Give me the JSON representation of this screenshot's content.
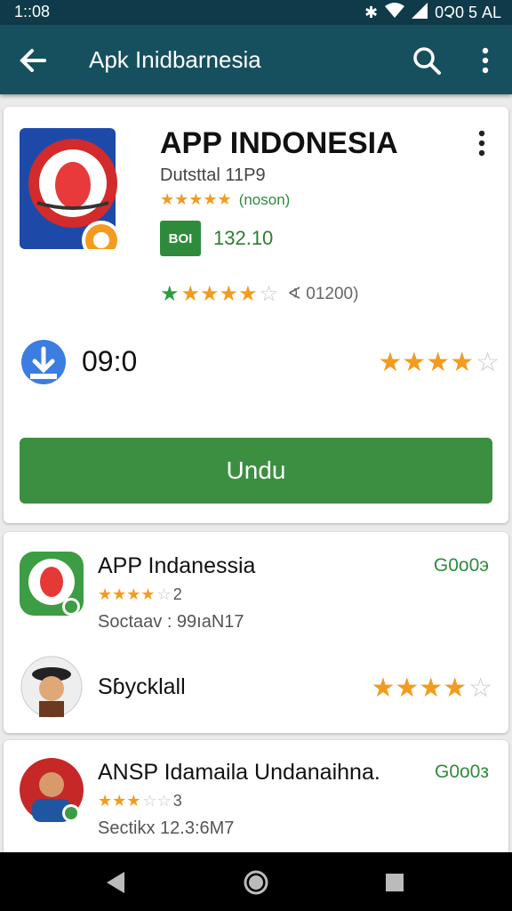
{
  "status_bar": {
    "time": "1::08",
    "right_text": "0Չ0 5 AL"
  },
  "app_bar": {
    "title": "Apk Inidbarnesia"
  },
  "main_app": {
    "title": "APP INDONESIA",
    "developer": "Dutsttal 11P9",
    "rating_stars": "★★★★★",
    "rating_reviews": "(noson)",
    "badge_label": "BOI",
    "size": "132.10",
    "review_count": "∢ 01200)",
    "install_count": "09:0",
    "install_button": "Undu"
  },
  "list": [
    {
      "title": "APP Indanessia",
      "price": "G0o0э",
      "rating_text": "2",
      "subtitle": "Soctaav : 99ıaN17"
    },
    {
      "title": "Sɓycklall",
      "price": "",
      "rating_text": "",
      "subtitle": ""
    },
    {
      "title": "ANSP Idamaila Undanaihna.",
      "price": "G0o0з",
      "rating_text": "3",
      "subtitle": "Sectikx 12.3:6M7"
    }
  ],
  "colors": {
    "appbar": "#16505f",
    "install_button": "#3c8f41",
    "accent_green": "#2e8b3c",
    "star": "#f29c1f"
  }
}
